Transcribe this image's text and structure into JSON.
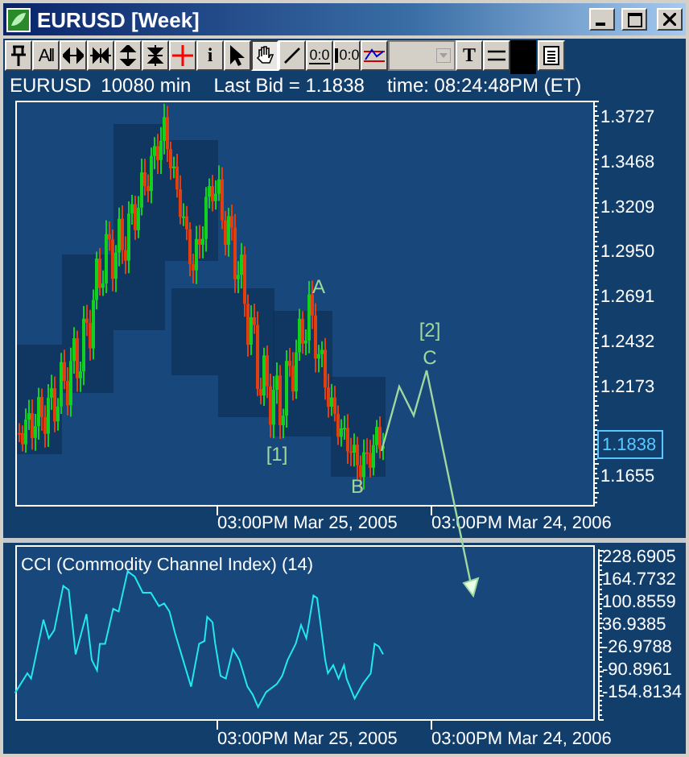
{
  "window": {
    "title": "EURUSD [Week]"
  },
  "toolbar": [
    {
      "kind": "pin",
      "selected": false
    },
    {
      "kind": "text",
      "label": "All",
      "selected": false
    },
    {
      "kind": "expand-h",
      "selected": false
    },
    {
      "kind": "compress-h",
      "selected": false
    },
    {
      "kind": "expand-v",
      "selected": false
    },
    {
      "kind": "compress-v",
      "selected": false
    },
    {
      "kind": "crosshair",
      "selected": false
    },
    {
      "kind": "text",
      "label": "i",
      "selected": false
    },
    {
      "kind": "pointer",
      "selected": false
    },
    {
      "kind": "hand",
      "selected": true
    },
    {
      "kind": "line",
      "selected": false
    },
    {
      "kind": "text-under",
      "label": "0:0",
      "selected": false
    },
    {
      "kind": "text-bar",
      "label": "0:0",
      "selected": false
    },
    {
      "kind": "wave",
      "selected": false
    },
    {
      "kind": "dropdown",
      "disabled": true,
      "selected": false
    },
    {
      "kind": "text",
      "label": "T",
      "selected": false
    },
    {
      "kind": "lines",
      "selected": false
    },
    {
      "kind": "gap",
      "selected": false
    },
    {
      "kind": "notes",
      "selected": false
    }
  ],
  "info": {
    "symbol": "EURUSD",
    "period": "10080 min",
    "last_bid": "Last Bid = 1.1838",
    "time": "time: 08:24:48PM (ET)"
  },
  "price_chart": {
    "y_ticks": [
      "1.3727",
      "1.3468",
      "1.3209",
      "1.2950",
      "1.2691",
      "1.2432",
      "1.2173",
      "1.1655"
    ],
    "last_price": "1.1838",
    "x_ticks": [
      "03:00PM Mar 25, 2005",
      "03:00PM Mar 24, 2006"
    ],
    "wave_labels": [
      "A",
      "[1]",
      "B",
      "[2]",
      "C"
    ]
  },
  "cci_chart": {
    "title": "CCI (Commodity Channel Index) (14)",
    "y_ticks": [
      "228.6905",
      "164.7732",
      "100.8559",
      "36.9385",
      "-26.9788",
      "-90.8961",
      "-154.8134"
    ],
    "x_ticks": [
      "03:00PM Mar 25, 2005",
      "03:00PM Mar 24, 2006"
    ]
  }
}
